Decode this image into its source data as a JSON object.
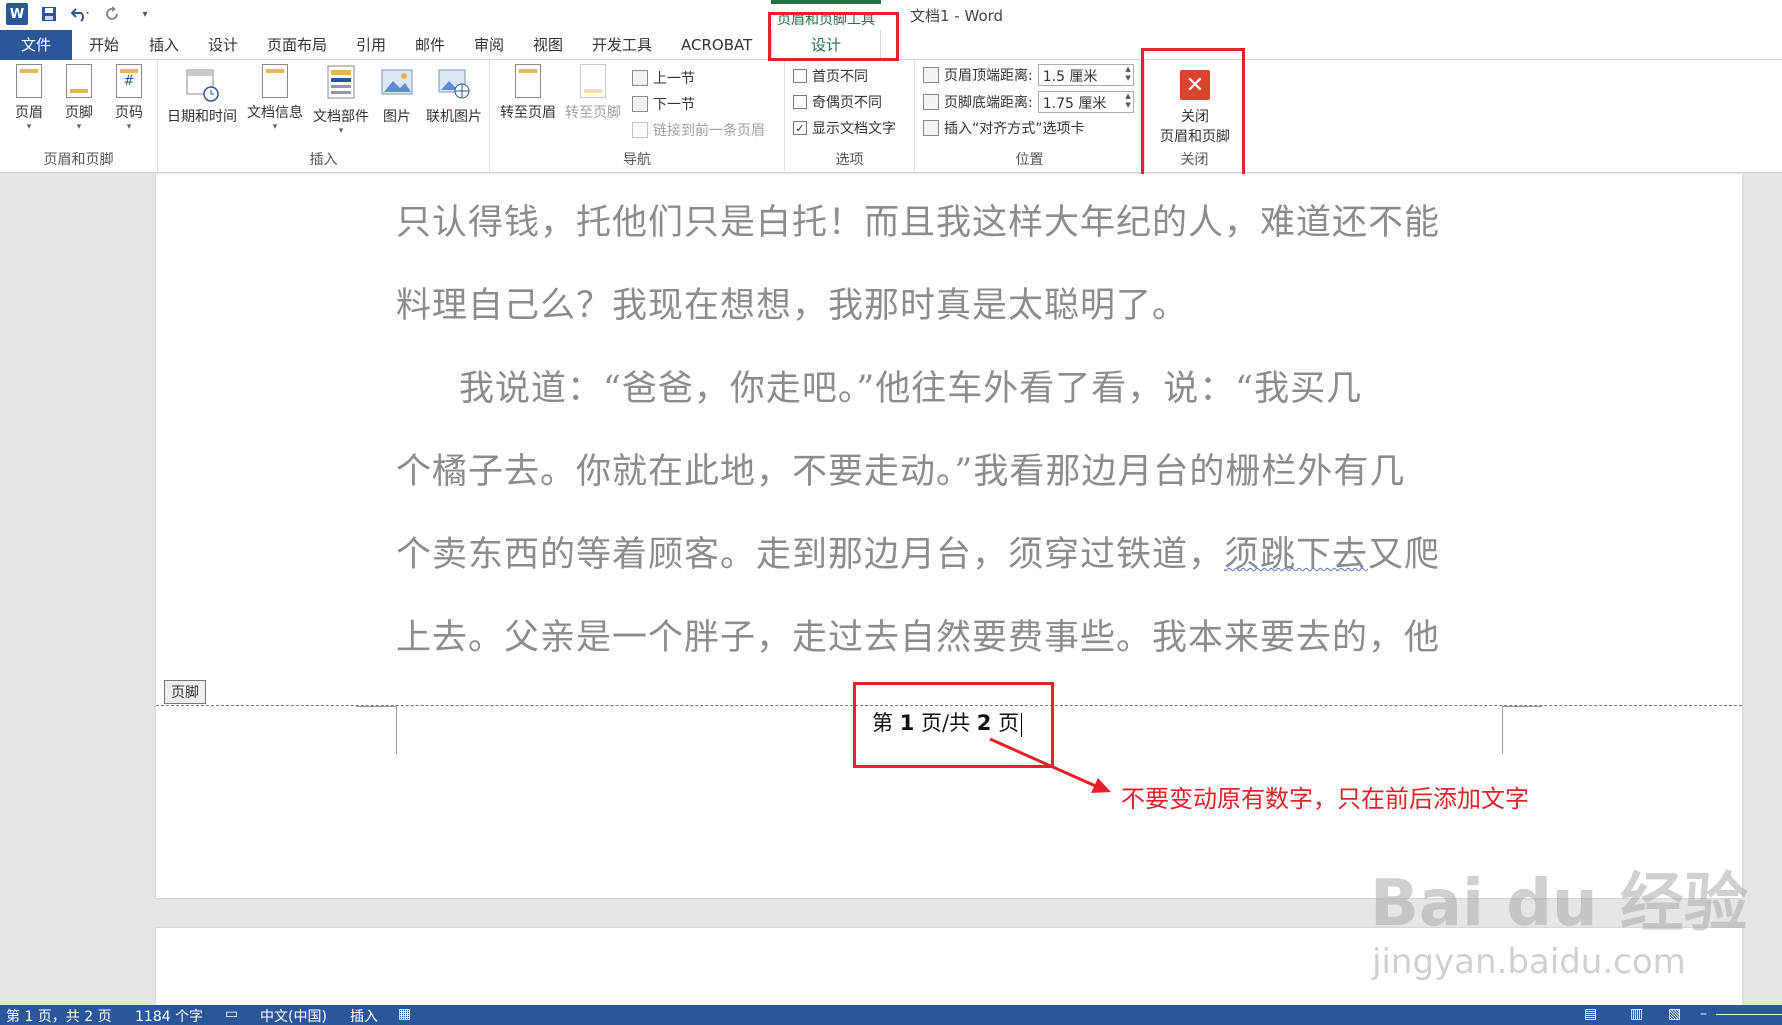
{
  "titlebar": {
    "app_icon": "W",
    "save_icon": "save-icon",
    "undo_icon": "undo-icon",
    "redo_icon": "redo-icon",
    "context_group": "页眉和页脚工具",
    "window_title": "文档1 - Word"
  },
  "tabs": [
    "文件",
    "开始",
    "插入",
    "设计",
    "页面布局",
    "引用",
    "邮件",
    "审阅",
    "视图",
    "开发工具",
    "ACROBAT",
    "设计"
  ],
  "ribbon": {
    "hf_group": {
      "label": "页眉和页脚",
      "header": "页眉",
      "footer": "页脚",
      "page_number": "页码"
    },
    "insert_group": {
      "label": "插入",
      "datetime": "日期和时间",
      "docinfo": "文档信息",
      "quickparts": "文档部件",
      "picture": "图片",
      "online_picture": "联机图片"
    },
    "nav_group": {
      "label": "导航",
      "goto_header": "转至页眉",
      "goto_footer": "转至页脚",
      "previous": "上一节",
      "next": "下一节",
      "link_previous": "链接到前一条页眉"
    },
    "options_group": {
      "label": "选项",
      "first_page": "首页不同",
      "odd_even": "奇偶页不同",
      "show_text": "显示文档文字"
    },
    "position_group": {
      "label": "位置",
      "header_top": "页眉顶端距离:",
      "header_top_value": "1.5 厘米",
      "footer_bottom": "页脚底端距离:",
      "footer_bottom_value": "1.75 厘米",
      "insert_align": "插入“对齐方式”选项卡"
    },
    "close_group": {
      "label": "关闭",
      "line1": "关闭",
      "line2": "页眉和页脚"
    }
  },
  "document": {
    "lines": [
      "只认得钱，托他们只是白托！而且我这样大年纪的人，难道还不能",
      "料理自己么？我现在想想，我那时真是太聪明了。",
      "我说道：“爸爸，你走吧。”他往车外看了看，说：“我买几",
      "个橘子去。你就在此地，不要走动。”我看那边月台的栅栏外有几",
      "个卖东西的等着顾客。走到那边月台，须穿过铁道，",
      "须跳下去",
      "又爬",
      "上去。父亲是一个胖子，走过去自然要费事些。我本来要去的，他"
    ],
    "footer_tag": "页脚",
    "footer_prefix": "第",
    "footer_page": "1",
    "footer_middle": "页/共",
    "footer_total": "2",
    "footer_suffix": "页"
  },
  "annotation": "不要变动原有数字，只在前后添加文字",
  "watermark": {
    "brand": "Bai  du 经验",
    "url": "jingyan.baidu.com"
  },
  "statusbar": {
    "page": "第 1 页，共 2 页",
    "words": "1184 个字",
    "language": "中文(中国)",
    "mode": "插入"
  },
  "colors": {
    "accent": "#2b579a",
    "context": "#217346",
    "highlight": "#e8202a"
  }
}
